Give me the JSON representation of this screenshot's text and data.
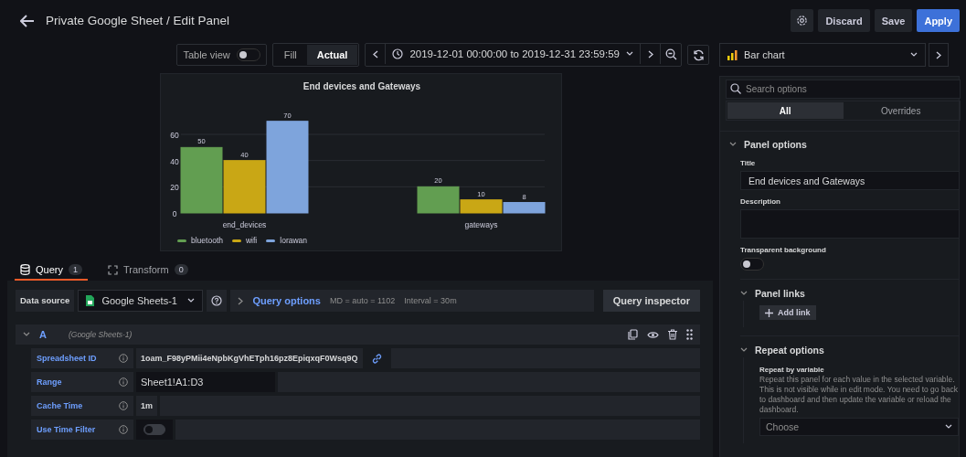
{
  "header": {
    "title": "Private Google Sheet / Edit Panel",
    "buttons": [
      {
        "kind": "icon"
      },
      {
        "kind": "text",
        "label": "Discard"
      },
      {
        "kind": "text",
        "label": "Save"
      },
      {
        "kind": "primary",
        "label": "Apply"
      }
    ]
  },
  "toolbar": {
    "table_view": {
      "label": "Table view",
      "on": false
    },
    "size_modes": [
      {
        "label": "Fill",
        "selected": false
      },
      {
        "label": "Actual",
        "selected": true
      }
    ],
    "time_range": "2019-12-01 00:00:00 to 2019-12-31 23:59:59"
  },
  "visualization": {
    "label": "Bar chart"
  },
  "panel": {
    "chart_data": {
      "type": "bar",
      "title": "End devices and Gateways",
      "categories": [
        "end_devices",
        "gateways"
      ],
      "series": [
        {
          "name": "bluetooth",
          "color": "#629e51",
          "values": [
            50,
            20
          ]
        },
        {
          "name": "wifi",
          "color": "#c9a715",
          "values": [
            40,
            10
          ]
        },
        {
          "name": "lorawan",
          "color": "#7ea4dc",
          "values": [
            70,
            8
          ]
        }
      ],
      "ylim": [
        0,
        70
      ],
      "yticks": [
        0,
        20,
        40,
        60
      ],
      "grid": true,
      "legend": "bottom",
      "data_labels": true
    }
  },
  "query_tabs": [
    {
      "label": "Query",
      "count": "1",
      "selected": true
    },
    {
      "label": "Transform",
      "count": "0",
      "selected": false
    }
  ],
  "data_source": {
    "label": "Data source",
    "value": "Google Sheets-1",
    "query_options": "Query options",
    "max_data_points": "MD = auto = 1102",
    "interval": "Interval = 30m",
    "inspector": "Query inspector"
  },
  "query": {
    "letter": "A",
    "source": "(Google Sheets-1)",
    "expanded": true,
    "fields": [
      {
        "label": "Spreadsheet ID",
        "kind": "text",
        "value": "1oam_F98yPMii4eNpbKgVhETph16pz8EpiqxqF0Wsq9Q",
        "link": true
      },
      {
        "label": "Range",
        "kind": "input",
        "value": "Sheet1!A1:D3"
      },
      {
        "label": "Cache Time",
        "kind": "text",
        "value": "1m"
      },
      {
        "label": "Use Time Filter",
        "kind": "switch",
        "on": false
      }
    ]
  },
  "options": {
    "search": {
      "placeholder": "Search options"
    },
    "tabs": [
      {
        "label": "All",
        "selected": true
      },
      {
        "label": "Overrides",
        "selected": false
      }
    ],
    "panel_options": {
      "title": "Panel options",
      "expanded": true,
      "title_label": "Title",
      "title_value": "End devices and Gateways",
      "description_label": "Description",
      "transparent_label": "Transparent background",
      "transparent_on": false
    },
    "panel_links": {
      "title": "Panel links",
      "expanded": true,
      "add": "Add link"
    },
    "repeat": {
      "title": "Repeat options",
      "expanded": true,
      "label": "Repeat by variable",
      "help": "Repeat this panel for each value in the selected variable. This is not visible while in edit mode. You need to go back to dashboard and then update the variable or reload the dashboard.",
      "placeholder": "Choose"
    }
  }
}
